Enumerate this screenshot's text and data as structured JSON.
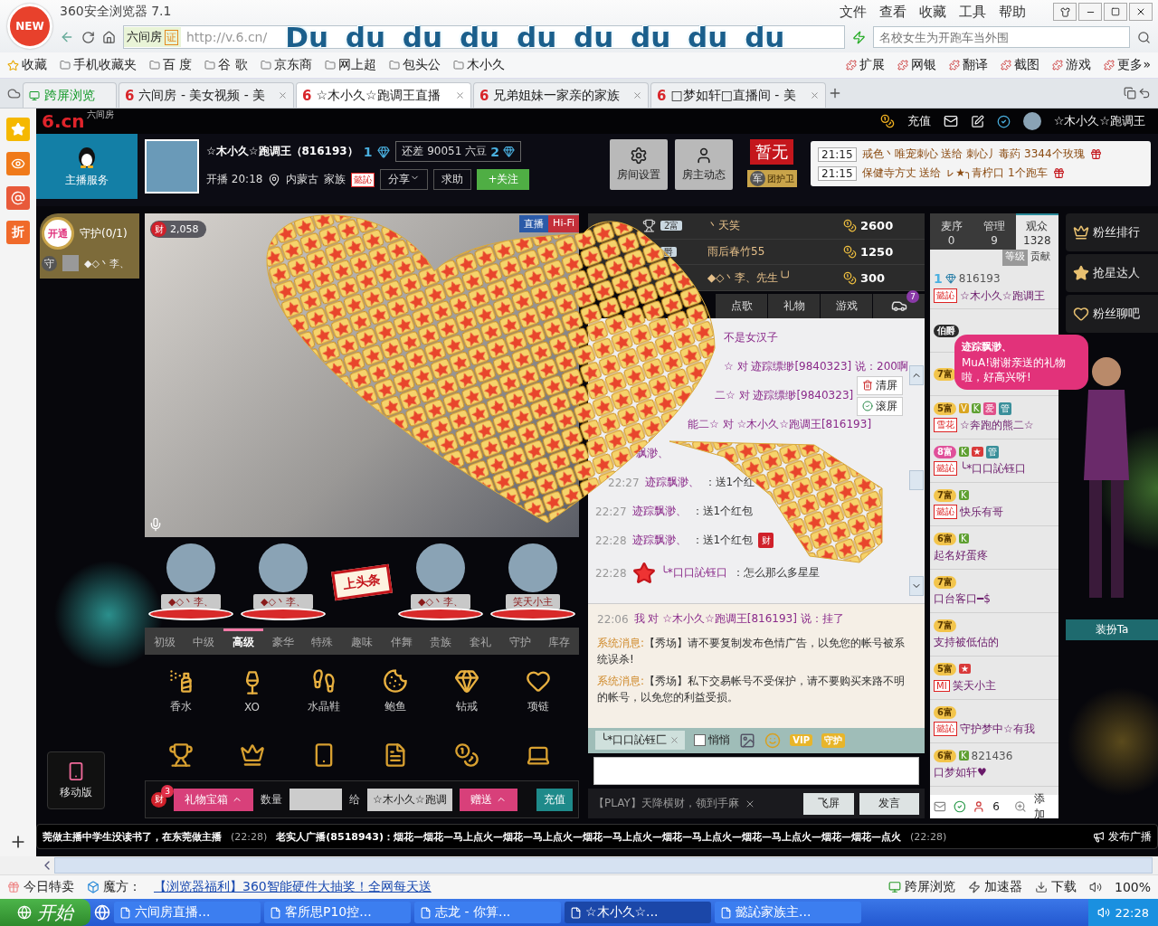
{
  "browser": {
    "logo": "NEW",
    "title": "360安全浏览器 7.1",
    "menu": [
      "文件",
      "查看",
      "收藏",
      "工具",
      "帮助"
    ],
    "site_tag": "六间房",
    "cert": "证",
    "url": "http://v.6.cn/",
    "overlay_text": "Du du du du du du du du du",
    "search": {
      "placeholder": "名校女生为开跑车当外围"
    },
    "bookmarks": [
      "收藏",
      "手机收藏夹",
      "百 度",
      "谷 歌",
      "京东商",
      "网上超",
      "包头公",
      "木小久"
    ],
    "tools": [
      "扩展",
      "网银",
      "翻译",
      "截图",
      "游戏",
      "更多»"
    ],
    "tabs": [
      {
        "kind": "pinned",
        "label": "跨屏浏览",
        "selected": false
      },
      {
        "kind": "page",
        "mark": "6",
        "label": "六间房 - 美女视频 - 美",
        "selected": false
      },
      {
        "kind": "page",
        "mark": "6",
        "label": "☆木小久☆跑调王直播",
        "selected": true
      },
      {
        "kind": "page",
        "mark": "6",
        "label": "兄弟姐妹一家亲的家族",
        "selected": false
      },
      {
        "kind": "page",
        "mark": "6",
        "label": "□梦如轩□直播间 - 美",
        "selected": false
      }
    ],
    "sidebar": {
      "discount": "折"
    }
  },
  "site": {
    "logo": "6.cn",
    "logo_sub": "六间房",
    "top": {
      "recharge": "充值",
      "user": "☆木小久☆跑调王"
    },
    "service": "主播服务",
    "host": {
      "name": "☆木小久☆跑调王（816193）",
      "level": "1",
      "need": "还差 90051 六豆",
      "next_level": "2",
      "start": "开播 20:18",
      "location": "内蒙古",
      "family_label": "家族",
      "family_badge": "懿訫",
      "share": "分享",
      "help": "求助",
      "follow": "+关注"
    },
    "room_buttons": [
      "房间设置",
      "房主动态"
    ],
    "flag": "暂无",
    "guard_mark": "军",
    "guard_team": "团护卫",
    "gift_news": [
      {
        "time": "21:15",
        "text": "戒色丶唯宠刺心 送给 刺心丿毒葯 3344个玫瑰"
      },
      {
        "time": "21:15",
        "text": "保健寺方丈 送给 ㇾ★╮青柠口 1个跑车"
      }
    ],
    "guards": {
      "open": "开通",
      "title": "守护(0/1)",
      "mark": "守",
      "member": "◆◇丶李、"
    },
    "video": {
      "wealth_mark": "财",
      "wealth": "2,058",
      "live": "直播",
      "hifi": "Hi-Fi"
    },
    "seats": [
      {
        "kind": "user",
        "name": "◆◇丶李、"
      },
      {
        "kind": "user",
        "name": "◆◇丶李、"
      },
      {
        "kind": "sign",
        "name": "上头条"
      },
      {
        "kind": "user",
        "name": "◆◇丶李、"
      },
      {
        "kind": "user",
        "name": "笑天小主"
      }
    ],
    "gift_tabs": [
      {
        "label": "初级",
        "selected": false
      },
      {
        "label": "中级",
        "selected": false
      },
      {
        "label": "高级",
        "selected": true
      },
      {
        "label": "豪华",
        "selected": false
      },
      {
        "label": "特殊",
        "selected": false
      },
      {
        "label": "趣味",
        "selected": false
      },
      {
        "label": "伴舞",
        "selected": false
      },
      {
        "label": "贵族",
        "selected": false
      },
      {
        "label": "套礼",
        "selected": false
      },
      {
        "label": "守护",
        "selected": false
      },
      {
        "label": "库存",
        "selected": false
      }
    ],
    "gifts": [
      "香水",
      "XO",
      "水晶鞋",
      "鲍鱼",
      "钻戒",
      "项链"
    ],
    "gift_bar": {
      "badge_count": "3",
      "badge": "财",
      "box": "礼物宝箱",
      "quantity_label": "数量",
      "to_label": "给",
      "recipient": "☆木小久☆跑调",
      "send": "赠送",
      "recharge": "充值"
    },
    "mobile": "移动版",
    "rank": [
      {
        "badge": "2富",
        "name": "丶天笑",
        "score": "2600"
      },
      {
        "badge": "爵",
        "name": "雨后春竹55",
        "score": "1250"
      },
      {
        "name": "◆◇丶李、先生╰╯",
        "score": "300"
      }
    ],
    "chat_tabs": [
      {
        "label": "点歌",
        "selected": false
      },
      {
        "label": "礼物",
        "selected": false
      },
      {
        "label": "游戏",
        "selected": false
      }
    ],
    "car_count": "7",
    "chat": [
      {
        "kind": "text",
        "text": "不是女汉子"
      },
      {
        "kind": "text",
        "text": "☆ 对 迹踪缥缈[9840323] 说：200啊"
      },
      {
        "kind": "text",
        "text": "二☆ 对 迹踪缥缈[9840323]"
      },
      {
        "kind": "text",
        "text": "能二☆ 对 ☆木小久☆跑调王[816193]"
      },
      {
        "kind": "text",
        "text": "飘渺、"
      },
      {
        "kind": "gift",
        "time": "22:27",
        "name": "迹踪飘渺、",
        "text": "：送1个红"
      },
      {
        "kind": "gift",
        "time": "22:27",
        "name": "迹踪飘渺、",
        "text": "：送1个红包"
      },
      {
        "kind": "gift",
        "time": "22:28",
        "name": "迹踪飘渺、",
        "text": "：送1个红包",
        "badge": "财"
      },
      {
        "kind": "star",
        "time": "22:28",
        "name": "╰*口口訫钰口",
        "text": "：怎么那么多星星"
      }
    ],
    "chat_buttons": [
      "清屏",
      "滚屏"
    ],
    "private": [
      {
        "kind": "me",
        "time": "22:06",
        "sender": "我",
        "to": "对",
        "target": "☆木小久☆跑调王[816193]",
        "said": "说：",
        "text": "挂了"
      },
      {
        "kind": "system",
        "label": "系统消息:",
        "text": "【秀场】请不要复制发布色情广告，以免您的帐号被系统误杀!"
      },
      {
        "kind": "system",
        "label": "系统消息:",
        "text": "【秀场】私下交易帐号不受保护，请不要购买来路不明的帐号，以免您的利益受损。"
      }
    ],
    "chat_tools": {
      "target": "╰*口口訫钰匚",
      "whisper": {
        "label": "悄悄",
        "checked": false
      },
      "vip": "VIP",
      "guard": "守护"
    },
    "promo": "【PLAY】天降横财，领到手麻",
    "fly": "飞屏",
    "send": "发言",
    "audience_tabs": [
      {
        "label": "麦序",
        "count": "0",
        "selected": false
      },
      {
        "label": "管理",
        "count": "9",
        "selected": false
      },
      {
        "label": "观众",
        "count": "1328",
        "selected": true
      }
    ],
    "sort": [
      {
        "label": "等级",
        "selected": true
      },
      {
        "label": "贡献",
        "selected": false
      }
    ],
    "audience": [
      {
        "kind": "host",
        "badge": "1",
        "id": "816193",
        "family": "懿訫",
        "name": "☆木小久☆跑调王"
      },
      {
        "kind": "viewer",
        "badge": "伯爵",
        "color": "#2b2b2b"
      },
      {
        "kind": "viewer",
        "badge": "7富",
        "color": "#f3c54c"
      },
      {
        "kind": "viewer",
        "badge": "5富",
        "color": "#f3c54c",
        "tags": [
          {
            "text": "V",
            "color": "#d9a520"
          },
          {
            "text": "K",
            "color": "#5fa032"
          },
          {
            "text": "爱",
            "color": "#e0508a"
          },
          {
            "text": "管",
            "color": "#3a8f9a"
          }
        ],
        "family": "雪花",
        "name": "☆奔跑的熊二☆"
      },
      {
        "kind": "viewer",
        "badge": "8富",
        "color": "#e0509a",
        "tags": [
          {
            "text": "K",
            "color": "#5fa032"
          },
          {
            "text": "★",
            "color": "#d93a3a"
          },
          {
            "text": "管",
            "color": "#3a8f9a"
          }
        ],
        "family": "懿訫",
        "name": "╰*口口訫钰口"
      },
      {
        "kind": "viewer",
        "badge": "7富",
        "color": "#f3c54c",
        "tags": [
          {
            "text": "K",
            "color": "#5fa032"
          }
        ],
        "family": "懿訫",
        "name": "快乐有哥"
      },
      {
        "kind": "viewer",
        "badge": "6富",
        "color": "#f3c54c",
        "tags": [
          {
            "text": "K",
            "color": "#5fa032"
          }
        ],
        "name": "起名好蛋疼"
      },
      {
        "kind": "viewer",
        "badge": "7富",
        "color": "#f3c54c",
        "name": "口台客口━$"
      },
      {
        "kind": "viewer",
        "badge": "7富",
        "color": "#f3c54c",
        "name": "支持被低估的"
      },
      {
        "kind": "viewer",
        "badge": "5富",
        "color": "#f3c54c",
        "tags": [
          {
            "text": "★",
            "color": "#d93a3a"
          }
        ],
        "family": "MI",
        "name": "笑天小主"
      },
      {
        "kind": "viewer",
        "badge": "6富",
        "color": "#f3c54c",
        "family": "懿訫",
        "name": "守护梦中☆有我"
      },
      {
        "kind": "viewer",
        "badge": "6富",
        "color": "#f3c54c",
        "tags": [
          {
            "text": "K",
            "color": "#5fa032"
          }
        ],
        "id": "821436",
        "name": "口梦如轩♥"
      }
    ],
    "audience_bar": {
      "count": "6",
      "add": "添加"
    },
    "bubble": {
      "name": "迹踪飘渺、",
      "text": "MuA!谢谢亲送的礼物啦，好高兴呀!"
    },
    "side_buttons": [
      "粉丝排行",
      "抢星达人",
      "粉丝聊吧"
    ],
    "dress": "装扮Ta",
    "ticker": [
      {
        "text": "莞做主播中学生没读书了，在东莞做主播",
        "time": "(22:28)"
      },
      {
        "text": "老实人广播(8518943)：烟花—烟花—马上点火—烟花—马上点火—烟花—马上点火—烟花—马上点火—烟花—马上点火—烟花—烟花—点火",
        "time": "(22:28)"
      }
    ],
    "broadcast": "发布广播"
  },
  "status": {
    "items": [
      "今日特卖",
      "魔方："
    ],
    "link": "【浏览器福利】360智能硬件大抽奖！全网每天送",
    "right": [
      "跨屏浏览",
      "加速器",
      "下载"
    ],
    "zoom": "100%"
  },
  "taskbar": {
    "start": "开始",
    "tasks": [
      {
        "label": "六间房直播...",
        "selected": false
      },
      {
        "label": "客所思P10控...",
        "selected": false
      },
      {
        "label": "志龙 - 你算...",
        "selected": false
      },
      {
        "label": "☆木小久☆...",
        "selected": true
      },
      {
        "label": "懿訫家族主...",
        "selected": false
      }
    ],
    "clock": "22:28"
  }
}
